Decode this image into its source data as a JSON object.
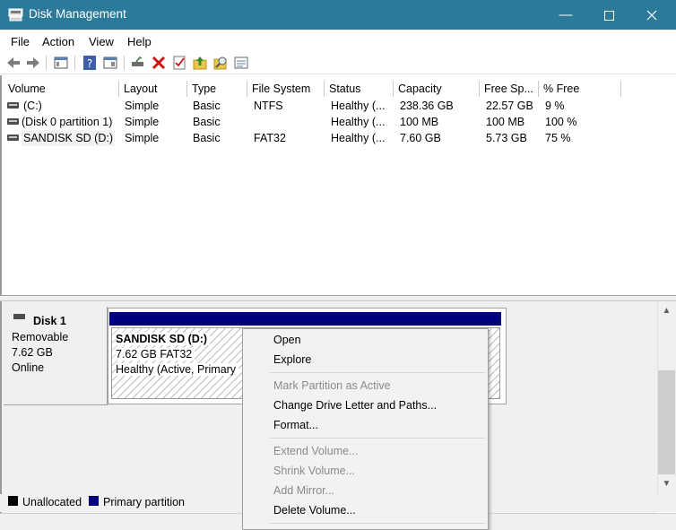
{
  "window": {
    "title": "Disk Management"
  },
  "menu": [
    "File",
    "Action",
    "View",
    "Help"
  ],
  "toolbar": {
    "icons": [
      "back-arrow-icon",
      "forward-arrow-icon",
      "console-tree-icon",
      "help-icon",
      "action-pane-icon",
      "connect-drive-icon",
      "delete-icon",
      "properties-check-icon",
      "upload-folder-icon",
      "search-folder-icon",
      "settings-list-icon"
    ]
  },
  "volumes": {
    "columns": [
      "Volume",
      "Layout",
      "Type",
      "File System",
      "Status",
      "Capacity",
      "Free Sp...",
      "% Free"
    ],
    "rows": [
      {
        "volume": "(C:)",
        "layout": "Simple",
        "type": "Basic",
        "fs": "NTFS",
        "status": "Healthy (...",
        "capacity": "238.36 GB",
        "free": "22.57 GB",
        "pct": "9 %"
      },
      {
        "volume": "(Disk 0 partition 1)",
        "layout": "Simple",
        "type": "Basic",
        "fs": "",
        "status": "Healthy (...",
        "capacity": "100 MB",
        "free": "100 MB",
        "pct": "100 %"
      },
      {
        "volume": "SANDISK SD (D:)",
        "layout": "Simple",
        "type": "Basic",
        "fs": "FAT32",
        "status": "Healthy (...",
        "capacity": "7.60 GB",
        "free": "5.73 GB",
        "pct": "75 %"
      }
    ]
  },
  "disk": {
    "name": "Disk 1",
    "type": "Removable",
    "size": "7.62 GB",
    "status": "Online",
    "partition": {
      "name": "SANDISK SD  (D:)",
      "size": "7.62 GB FAT32",
      "status": "Healthy (Active, Primary"
    }
  },
  "legend": {
    "unallocated": "Unallocated",
    "primary": "Primary partition"
  },
  "context_menu": {
    "open": "Open",
    "explore": "Explore",
    "mark_active": "Mark Partition as Active",
    "change_letter": "Change Drive Letter and Paths...",
    "format": "Format...",
    "extend": "Extend Volume...",
    "shrink": "Shrink Volume...",
    "add_mirror": "Add Mirror...",
    "delete": "Delete Volume..."
  },
  "colors": {
    "titlebar": "#2b7a9a",
    "primary_partition": "#000080",
    "unallocated": "#000000"
  }
}
